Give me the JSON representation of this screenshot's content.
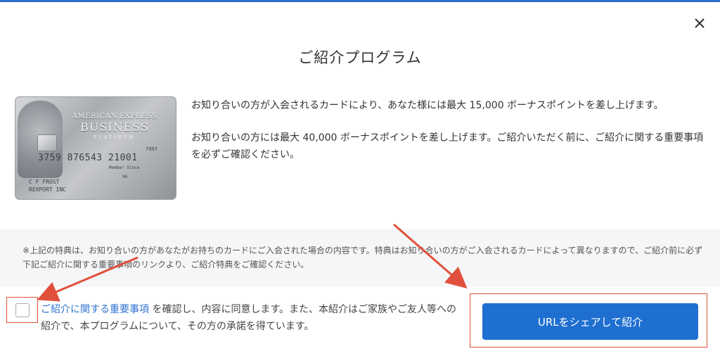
{
  "modal": {
    "title": "ご紹介プログラム",
    "close_icon": "close-icon"
  },
  "card": {
    "brand": "AMERICAN EXPRESS",
    "product": "BUSINESS",
    "tier": "PLATINUM",
    "number": "3759 876543 21001",
    "card_id": "7997",
    "holder_line1": "C F FROST",
    "holder_line2": "REXPORT INC",
    "member_since_label": "Member Since",
    "member_since_value": "96"
  },
  "description": {
    "para1": "お知り合いの方が入会されるカードにより、あなた様には最大 15,000 ボーナスポイントを差し上げます。",
    "para2": "お知り合いの方には最大 40,000 ボーナスポイントを差し上げます。ご紹介いただく前に、ご紹介に関する重要事項を必ずご確認ください。"
  },
  "notice": {
    "text": "※上記の特典は、お知り合いの方があなたがお持ちのカードにご入会された場合の内容です。特典はお知り合いの方がご入会されるカードによって異なりますので、ご紹介前に必ず下記ご紹介に関する重要事項のリンクより、ご紹介特典をご確認ください。"
  },
  "consent": {
    "checked": false,
    "link_text": "ご紹介に関する重要事項",
    "text": " を確認し、内容に同意します。また、本紹介はご家族やご友人等への紹介で、本プログラムについて、その方の承諾を得ています。"
  },
  "share": {
    "button_label": "URLをシェアして紹介"
  },
  "colors": {
    "primary": "#1f6fd1",
    "link": "#2e72d2",
    "annotation": "#e0503c",
    "notice_bg": "#f5f6f7"
  }
}
